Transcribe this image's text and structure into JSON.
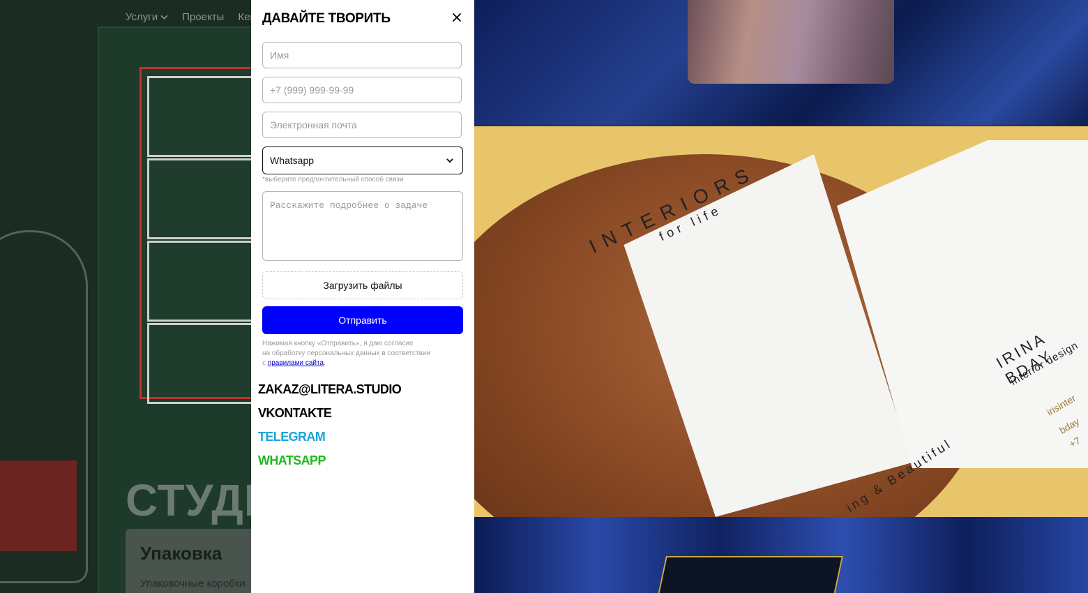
{
  "background": {
    "nav": [
      {
        "label": "Услуги",
        "has_dropdown": true
      },
      {
        "label": "Проекты",
        "has_dropdown": false
      },
      {
        "label": "Кей",
        "has_dropdown": false
      }
    ],
    "hero_text": "СТУДИ",
    "card_title": "Упаковка",
    "card_subtitle": "Упаковочные коробки"
  },
  "modal": {
    "title": "ДАВАЙТЕ ТВОРИТЬ",
    "fields": {
      "name_placeholder": "Имя",
      "phone_placeholder": "+7 (999) 999-99-99",
      "email_placeholder": "Электронная почта"
    },
    "contact_method": {
      "selected": "Whatsapp",
      "hint": "*выберите предпочтительный способ связи"
    },
    "message_placeholder": "Расскажите подробнее о задаче",
    "upload_label": "Загрузить файлы",
    "submit_label": "Отправить",
    "consent": {
      "text_1": "Нажимая кнопку «Отправить», я даю согласие",
      "text_2": "на обработку персональных данных в соответствии",
      "text_3": "с ",
      "link": "правилами сайта",
      "suffix": "."
    },
    "contacts": [
      {
        "label": "ZAKAZ@LITERA.STUDIO",
        "color": "#000000"
      },
      {
        "label": "VKONTAKTE",
        "color": "#000000"
      },
      {
        "label": "TELEGRAM",
        "color": "#1ea3d8"
      },
      {
        "label": "WHATSAPP",
        "color": "#1fb81f"
      }
    ]
  },
  "photos": {
    "interiors_card": {
      "brand": "INTERIORS",
      "tagline": "for life",
      "slogan": "ing & Beautiful",
      "name": "IRINA BDAY",
      "role": "interior design",
      "contact_1": "irisinter",
      "contact_2": "bday",
      "contact_3": "+7"
    }
  },
  "colors": {
    "submit_button": "#0000ff",
    "telegram": "#1ea3d8",
    "whatsapp": "#1fb81f"
  }
}
